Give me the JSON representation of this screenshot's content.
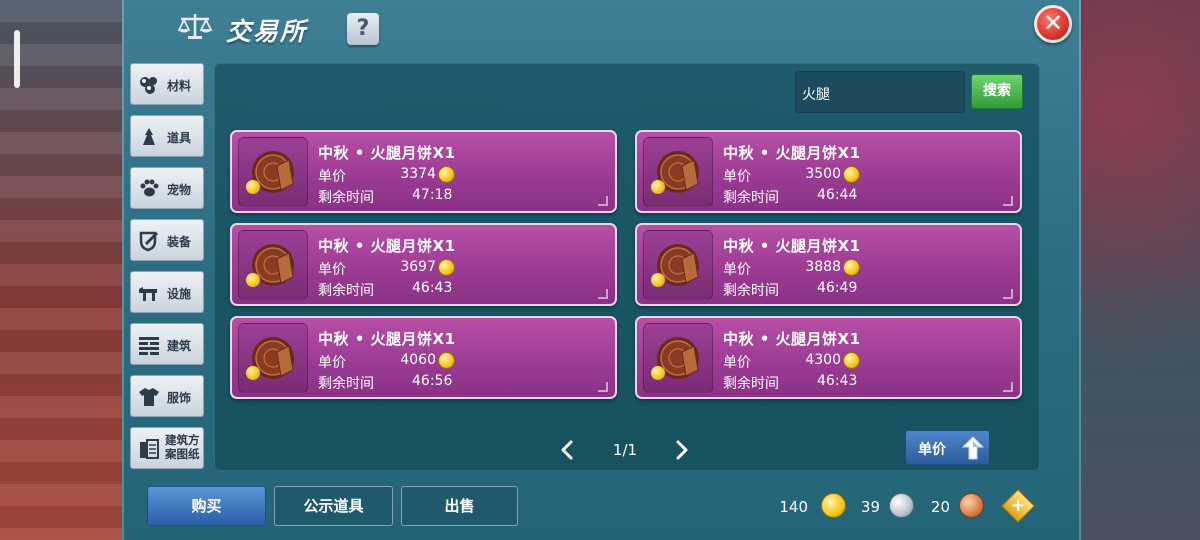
{
  "window": {
    "title": "交易所",
    "help_label": "?",
    "close_label": "✕"
  },
  "categories": [
    {
      "label": "材料",
      "icon": "materials-icon"
    },
    {
      "label": "道具",
      "icon": "item-icon"
    },
    {
      "label": "宠物",
      "icon": "pet-paw-icon"
    },
    {
      "label": "装备",
      "icon": "equipment-icon"
    },
    {
      "label": "设施",
      "icon": "facility-icon"
    },
    {
      "label": "建筑",
      "icon": "building-icon"
    },
    {
      "label": "服饰",
      "icon": "clothing-icon"
    },
    {
      "label": "建筑方案图纸",
      "line1": "建筑方",
      "line2": "案图纸",
      "icon": "blueprint-icon"
    }
  ],
  "search": {
    "value": "火腿",
    "button_label": "搜索"
  },
  "listings": [
    {
      "name": "中秋 • 火腿月饼X1",
      "price_label": "单价",
      "price": "3374",
      "time_label": "剩余时间",
      "time": "47:18"
    },
    {
      "name": "中秋 • 火腿月饼X1",
      "price_label": "单价",
      "price": "3500",
      "time_label": "剩余时间",
      "time": "46:44"
    },
    {
      "name": "中秋 • 火腿月饼X1",
      "price_label": "单价",
      "price": "3697",
      "time_label": "剩余时间",
      "time": "46:43"
    },
    {
      "name": "中秋 • 火腿月饼X1",
      "price_label": "单价",
      "price": "3888",
      "time_label": "剩余时间",
      "time": "46:49"
    },
    {
      "name": "中秋 • 火腿月饼X1",
      "price_label": "单价",
      "price": "4060",
      "time_label": "剩余时间",
      "time": "46:56"
    },
    {
      "name": "中秋 • 火腿月饼X1",
      "price_label": "单价",
      "price": "4300",
      "time_label": "剩余时间",
      "time": "46:43"
    }
  ],
  "pagination": {
    "text": "1/1"
  },
  "sort": {
    "label": "单价"
  },
  "actions": {
    "buy": "购买",
    "public": "公示道具",
    "sell": "出售"
  },
  "currency": {
    "gold": "140",
    "silver": "39",
    "bronze": "20"
  },
  "colors": {
    "card_purple": "#a8459d",
    "buy_blue": "#3f77bf",
    "search_green": "#3aa845",
    "close_red": "#d3322d"
  }
}
